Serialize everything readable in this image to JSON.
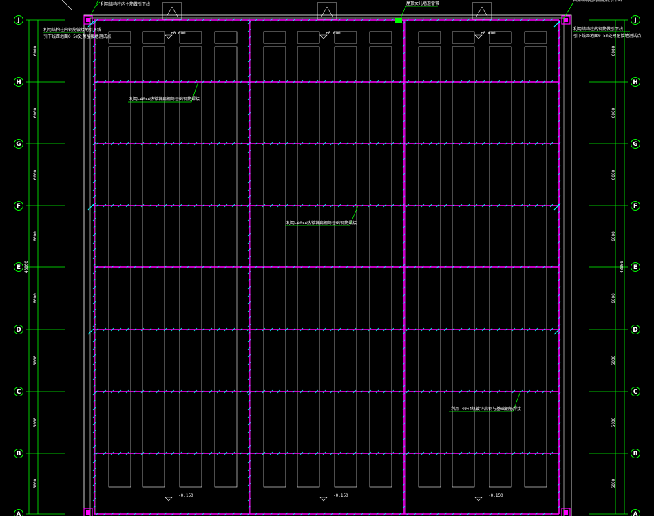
{
  "drawing": {
    "axes": [
      "J",
      "H",
      "G",
      "F",
      "E",
      "D",
      "C",
      "B",
      "A"
    ],
    "bay_dims": [
      "6000",
      "6000",
      "6000",
      "6000",
      "6000",
      "6000",
      "6000",
      "6000"
    ],
    "total_dim": "48000",
    "elev_top": [
      "±0.000",
      "±0.000",
      "±0.000"
    ],
    "elev_bottom": [
      "-0.150",
      "-0.150",
      "-0.150"
    ],
    "annotations": {
      "top_left_1": "利用结构柱内主筋做引下线",
      "top_left_2": "利用结构柱内钢筋做接地引下线",
      "top_left_3": "引下线距地面0.5m处预留接地测试点",
      "top_center": "屋顶女儿墙避雷带",
      "top_right_1": "利用结构柱内钢筋做引下线",
      "top_right_2": "引下线距地面0.5m处预留接地测试点",
      "mid_left": "利用-40×4热镀锌扁钢与基础钢筋焊接",
      "mid_center": "利用-40×4热镀锌扁钢与基础钢筋焊接",
      "bottom_right": "利用-40×4热镀锌扁钢与基础钢筋焊接"
    },
    "colors": {
      "background": "#000000",
      "grid_line": "#00ff00",
      "ground_conductor": "#ff00ff",
      "ground_hatch": "#00ffff",
      "outline": "#ffffff"
    }
  }
}
